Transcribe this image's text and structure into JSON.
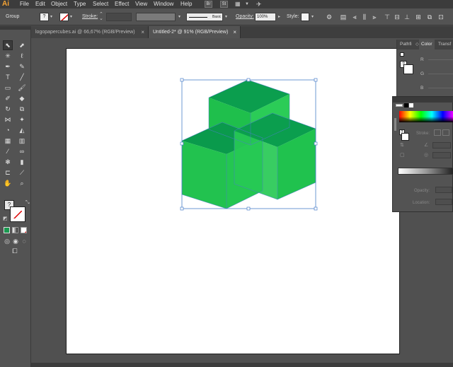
{
  "menubar": {
    "logo": "Ai",
    "items": [
      "File",
      "Edit",
      "Object",
      "Type",
      "Select",
      "Effect",
      "View",
      "Window",
      "Help"
    ],
    "bridge_label": "Br",
    "stock_label": "St"
  },
  "controlbar": {
    "selection_label": "Group",
    "stroke_label": "Stroke:",
    "stroke_profile": "Basic",
    "opacity_label": "Opacity:",
    "opacity_value": "100%",
    "style_label": "Style:"
  },
  "tabs": [
    {
      "label": "logopapercubes.ai @ 66,67% (RGB/Preview)",
      "close": "×"
    },
    {
      "label": "Untitled-2* @ 91% (RGB/Preview)",
      "close": "×"
    }
  ],
  "panel_top": {
    "tabs": [
      "Pathfi",
      "Color",
      "Transf"
    ],
    "r_label": "R",
    "g_label": "G",
    "b_label": "B"
  },
  "panel_float": {
    "stroke_label": "Stroke:",
    "opacity_label": "Opacity:",
    "location_label": "Location:"
  },
  "colors": {
    "cube_top": "#0b9e4e",
    "cube_face": "#22c24f",
    "cube_side": "#2bd15a",
    "selection": "#4a7fc9",
    "fill_swatch": "#1a9950"
  },
  "icons": {
    "fill_none": "question-mark",
    "stroke_none": "red-slash"
  }
}
